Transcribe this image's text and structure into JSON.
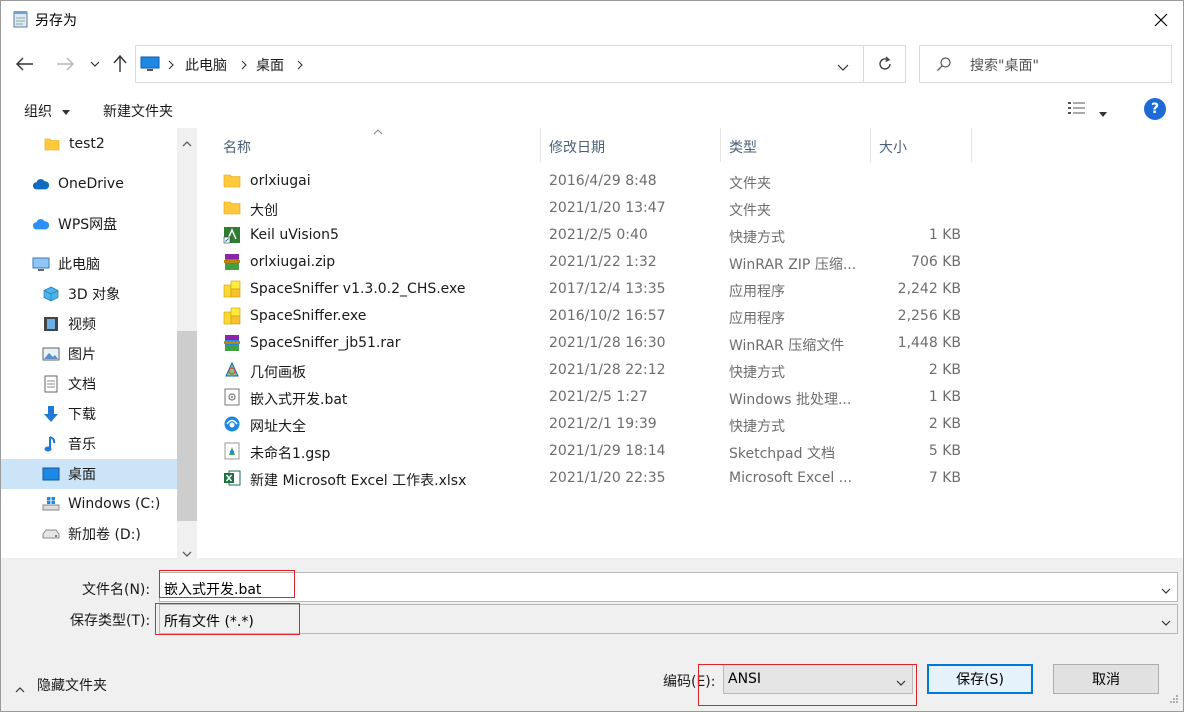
{
  "window": {
    "title": "另存为"
  },
  "address": {
    "crumbs": [
      "此电脑",
      "桌面"
    ]
  },
  "search": {
    "placeholder": "搜索\"桌面\""
  },
  "toolbar": {
    "organize_label": "组织",
    "new_folder_label": "新建文件夹"
  },
  "nav": {
    "items": [
      {
        "label": "test2",
        "icon": "folder-icon"
      },
      {
        "label": "OneDrive",
        "icon": "cloud-icon"
      },
      {
        "label": "WPS网盘",
        "icon": "cloud-icon"
      },
      {
        "label": "此电脑",
        "icon": "computer-icon"
      },
      {
        "label": "3D 对象",
        "icon": "cube-icon"
      },
      {
        "label": "视频",
        "icon": "film-icon"
      },
      {
        "label": "图片",
        "icon": "picture-icon"
      },
      {
        "label": "文档",
        "icon": "document-icon"
      },
      {
        "label": "下载",
        "icon": "download-arrow-icon"
      },
      {
        "label": "音乐",
        "icon": "music-note-icon"
      },
      {
        "label": "桌面",
        "icon": "desktop-icon",
        "selected": true
      },
      {
        "label": "Windows (C:)",
        "icon": "drive-icon"
      },
      {
        "label": "新加卷 (D:)",
        "icon": "drive-icon"
      }
    ]
  },
  "columns": {
    "name": "名称",
    "date": "修改日期",
    "type": "类型",
    "size": "大小"
  },
  "files": [
    {
      "name": "orlxiugai",
      "date": "2016/4/29 8:48",
      "type": "文件夹",
      "size": "",
      "icon": "folder-icon"
    },
    {
      "name": "大创",
      "date": "2021/1/20 13:47",
      "type": "文件夹",
      "size": "",
      "icon": "folder-icon"
    },
    {
      "name": "Keil uVision5",
      "date": "2021/2/5 0:40",
      "type": "快捷方式",
      "size": "1 KB",
      "icon": "keil-shortcut-icon"
    },
    {
      "name": "orlxiugai.zip",
      "date": "2021/1/22 1:32",
      "type": "WinRAR ZIP 压缩...",
      "size": "706 KB",
      "icon": "winrar-icon"
    },
    {
      "name": "SpaceSniffer v1.3.0.2_CHS.exe",
      "date": "2017/12/4 13:35",
      "type": "应用程序",
      "size": "2,242 KB",
      "icon": "spacesniffer-icon"
    },
    {
      "name": "SpaceSniffer.exe",
      "date": "2016/10/2 16:57",
      "type": "应用程序",
      "size": "2,256 KB",
      "icon": "spacesniffer-icon"
    },
    {
      "name": "SpaceSniffer_jb51.rar",
      "date": "2021/1/28 16:30",
      "type": "WinRAR 压缩文件",
      "size": "1,448 KB",
      "icon": "winrar-icon"
    },
    {
      "name": "几何画板",
      "date": "2021/1/28 22:12",
      "type": "快捷方式",
      "size": "2 KB",
      "icon": "geometry-shortcut-icon"
    },
    {
      "name": "嵌入式开发.bat",
      "date": "2021/2/5 1:27",
      "type": "Windows 批处理...",
      "size": "1 KB",
      "icon": "batch-file-icon"
    },
    {
      "name": "网址大全",
      "date": "2021/2/1 19:39",
      "type": "快捷方式",
      "size": "2 KB",
      "icon": "browser-shortcut-icon"
    },
    {
      "name": "未命名1.gsp",
      "date": "2021/1/29 18:14",
      "type": "Sketchpad 文档",
      "size": "5 KB",
      "icon": "sketchpad-icon"
    },
    {
      "name": "新建 Microsoft Excel 工作表.xlsx",
      "date": "2021/1/20 22:35",
      "type": "Microsoft Excel ...",
      "size": "7 KB",
      "icon": "excel-icon"
    }
  ],
  "form": {
    "filename_label": "文件名(N):",
    "filename_value": "嵌入式开发.bat",
    "filetype_label": "保存类型(T):",
    "filetype_value": "所有文件  (*.*)",
    "encoding_label": "编码(E):",
    "encoding_value": "ANSI"
  },
  "footer": {
    "hide_folders_label": "隐藏文件夹",
    "save_label": "保存(S)",
    "cancel_label": "取消"
  },
  "colors": {
    "selection": "#cce4f7",
    "accent": "#0078d7",
    "highlight_box": "#e0242b"
  }
}
